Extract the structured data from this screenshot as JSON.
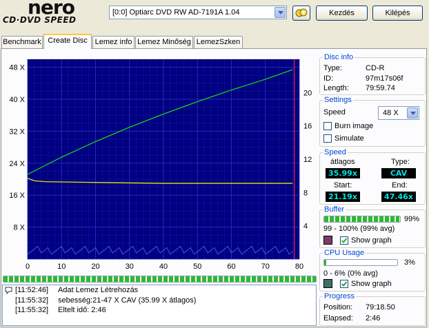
{
  "header": {
    "logo_brand": "nero",
    "logo_sub": "CD·DVD SPEED",
    "drive": "[0:0]  Optiarc DVD RW AD-7191A 1.04",
    "swap_icon": "swap-disc-icon",
    "start_label": "Kezdés",
    "exit_label": "Kilépés"
  },
  "tabs": [
    "Benchmark",
    "Create Disc",
    "Lemez info",
    "Lemez Minőség",
    "LemezSzken"
  ],
  "active_tab": "Create Disc",
  "disc_info": {
    "title": "Disc info",
    "type_label": "Type:",
    "type": "CD-R",
    "id_label": "ID:",
    "id": "97m17s06f",
    "length_label": "Length:",
    "length": "79:59.74"
  },
  "settings": {
    "title": "Settings",
    "speed_label": "Speed",
    "speed_value": "48 X",
    "burn_image": "Burn image",
    "simulate": "Simulate"
  },
  "speed": {
    "title": "Speed",
    "avg_label": "átlagos",
    "avg": "35.99x",
    "type_label": "Type:",
    "type": "CAV",
    "start_label": "Start:",
    "start": "21.19x",
    "end_label": "End:",
    "end": "47.46x"
  },
  "buffer": {
    "title": "Buffer",
    "level": 0.99,
    "pct": "99%",
    "range": "99 - 100% (99% avg)",
    "show_graph": "Show graph",
    "color": "#7d3a6e"
  },
  "cpu": {
    "title": "CPU Usage",
    "level": 0.03,
    "pct": "3%",
    "range": "0 - 6% (0% avg)",
    "show_graph": "Show graph",
    "color": "#3f6f68"
  },
  "progress": {
    "title": "Progress",
    "position_label": "Position:",
    "position": "79:18.50",
    "elapsed_label": "Elapsed:",
    "elapsed": "2:46"
  },
  "log": [
    {
      "time": "[11:52:46]",
      "text": "Adat Lemez Létrehozás",
      "icon": "info-icon"
    },
    {
      "time": "[11:55:32]",
      "text": "sebesség:21-47 X CAV (35.99 X átlagos)"
    },
    {
      "time": "[11:55:32]",
      "text": "Eltelt idő:  2:46"
    }
  ],
  "chart_data": {
    "type": "line",
    "x_ticks": [
      "0",
      "10",
      "20",
      "30",
      "40",
      "50",
      "60",
      "70",
      "80"
    ],
    "y_left_ticks": [
      "8 X",
      "16 X",
      "24 X",
      "32 X",
      "40 X",
      "48 X"
    ],
    "y_right_ticks": [
      "4",
      "8",
      "12",
      "16",
      "20"
    ],
    "xlim": [
      0,
      80
    ],
    "ylim_left": [
      0,
      50
    ],
    "ylim_right": [
      0,
      24
    ],
    "colors": {
      "background": "#000080",
      "grid": "#2a2ad0",
      "speed": "#18d018",
      "rpm": "#e8e800",
      "buffer": "#3f55e6",
      "marker": "#ff2020"
    },
    "series": [
      {
        "id": "speed",
        "x": [
          0,
          10,
          20,
          30,
          40,
          50,
          60,
          70,
          78
        ],
        "y": [
          21.2,
          25.5,
          29.4,
          33.0,
          36.3,
          39.4,
          42.3,
          45.0,
          47.4
        ]
      },
      {
        "id": "rpm",
        "x": [
          0,
          2,
          5,
          20,
          40,
          60,
          78
        ],
        "y": [
          9.7,
          9.4,
          9.3,
          9.2,
          9.1,
          9.1,
          9.1
        ]
      }
    ],
    "marker_x": 78.5
  }
}
